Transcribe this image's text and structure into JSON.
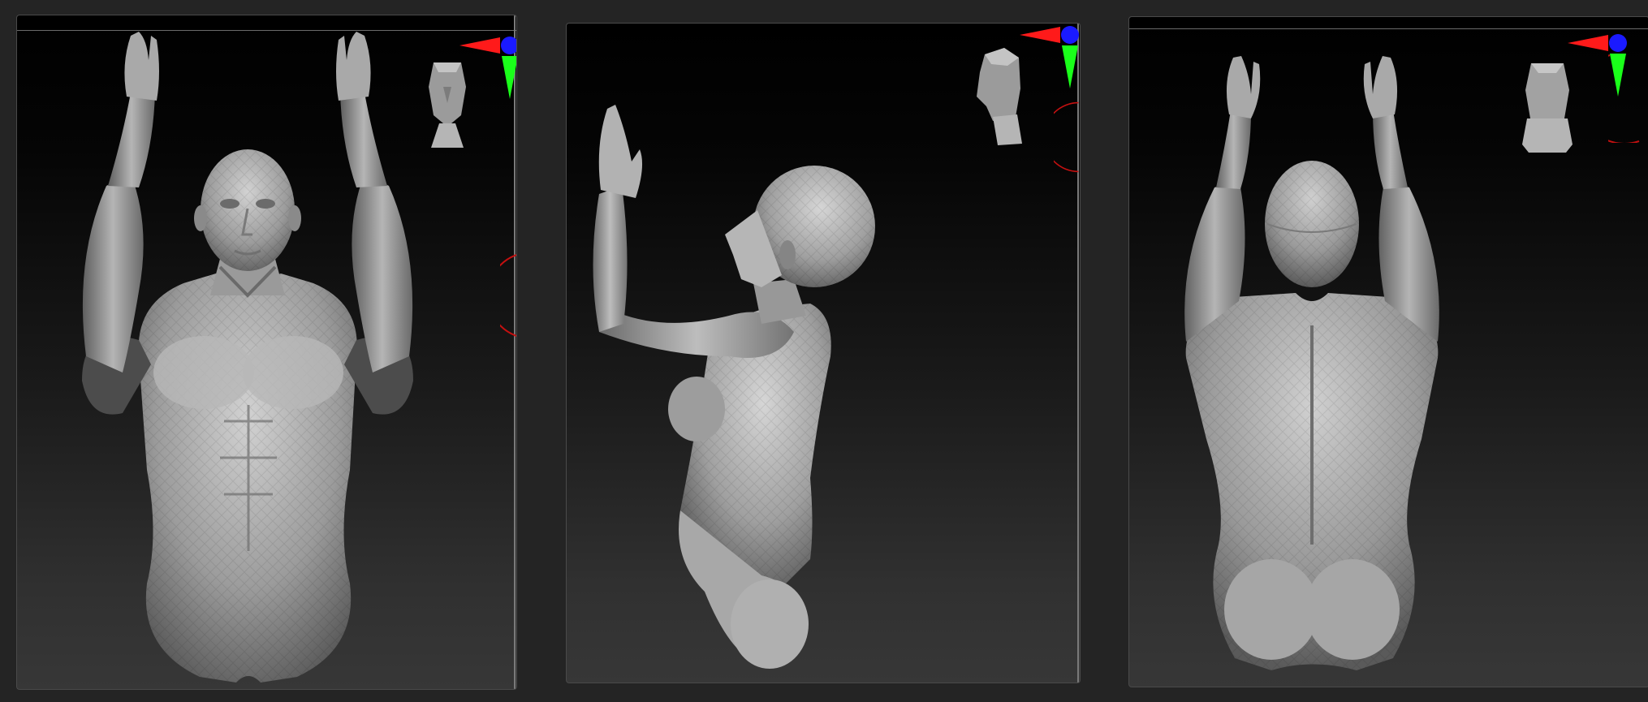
{
  "app": {
    "views": [
      {
        "id": "front",
        "orientation": "front",
        "nav_icon": "head-front-icon"
      },
      {
        "id": "side",
        "orientation": "side",
        "nav_icon": "head-side-icon"
      },
      {
        "id": "back",
        "orientation": "back",
        "nav_icon": "head-back-icon"
      }
    ]
  },
  "colors": {
    "background": "#242424",
    "viewport_top": "#000000",
    "viewport_bottom": "#373737",
    "axis_x": "#ff1a1a",
    "axis_y": "#1aff1a",
    "axis_z": "#1a1aff",
    "mesh": "#9a9a9a"
  }
}
